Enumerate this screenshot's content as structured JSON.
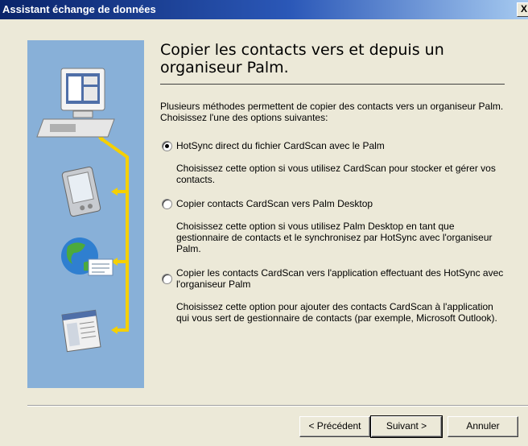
{
  "window": {
    "title": "Assistant échange de données",
    "close_label": "X"
  },
  "page": {
    "heading": "Copier les contacts vers et depuis un organiseur Palm.",
    "intro": "Plusieurs méthodes permettent de copier des contacts vers un organiseur Palm. Choisissez l'une des options suivantes:"
  },
  "options": [
    {
      "label": "HotSync direct du fichier CardScan avec le Palm",
      "description": "Choisissez cette option si vous utilisez CardScan pour stocker et gérer vos contacts.",
      "checked": true
    },
    {
      "label": "Copier contacts CardScan vers Palm Desktop",
      "description": "Choisissez cette option si vous utilisez Palm Desktop en tant que gestionnaire de contacts et le synchronisez par HotSync avec l'organiseur Palm.",
      "checked": false
    },
    {
      "label": "Copier les contacts CardScan vers l'application effectuant des HotSync avec l'organiseur Palm",
      "description": "Choisissez cette option pour ajouter des contacts CardScan à l'application qui vous sert de gestionnaire de contacts (par exemple, Microsoft Outlook).",
      "checked": false
    }
  ],
  "buttons": {
    "back": "< Précédent",
    "next": "Suivant >",
    "cancel": "Annuler"
  },
  "side_panel": {
    "icons": [
      "computer-icon",
      "palm-handheld-icon",
      "globe-email-icon",
      "application-window-icon"
    ],
    "connector_color": "#f5d000",
    "background_color": "#88b0d8"
  }
}
